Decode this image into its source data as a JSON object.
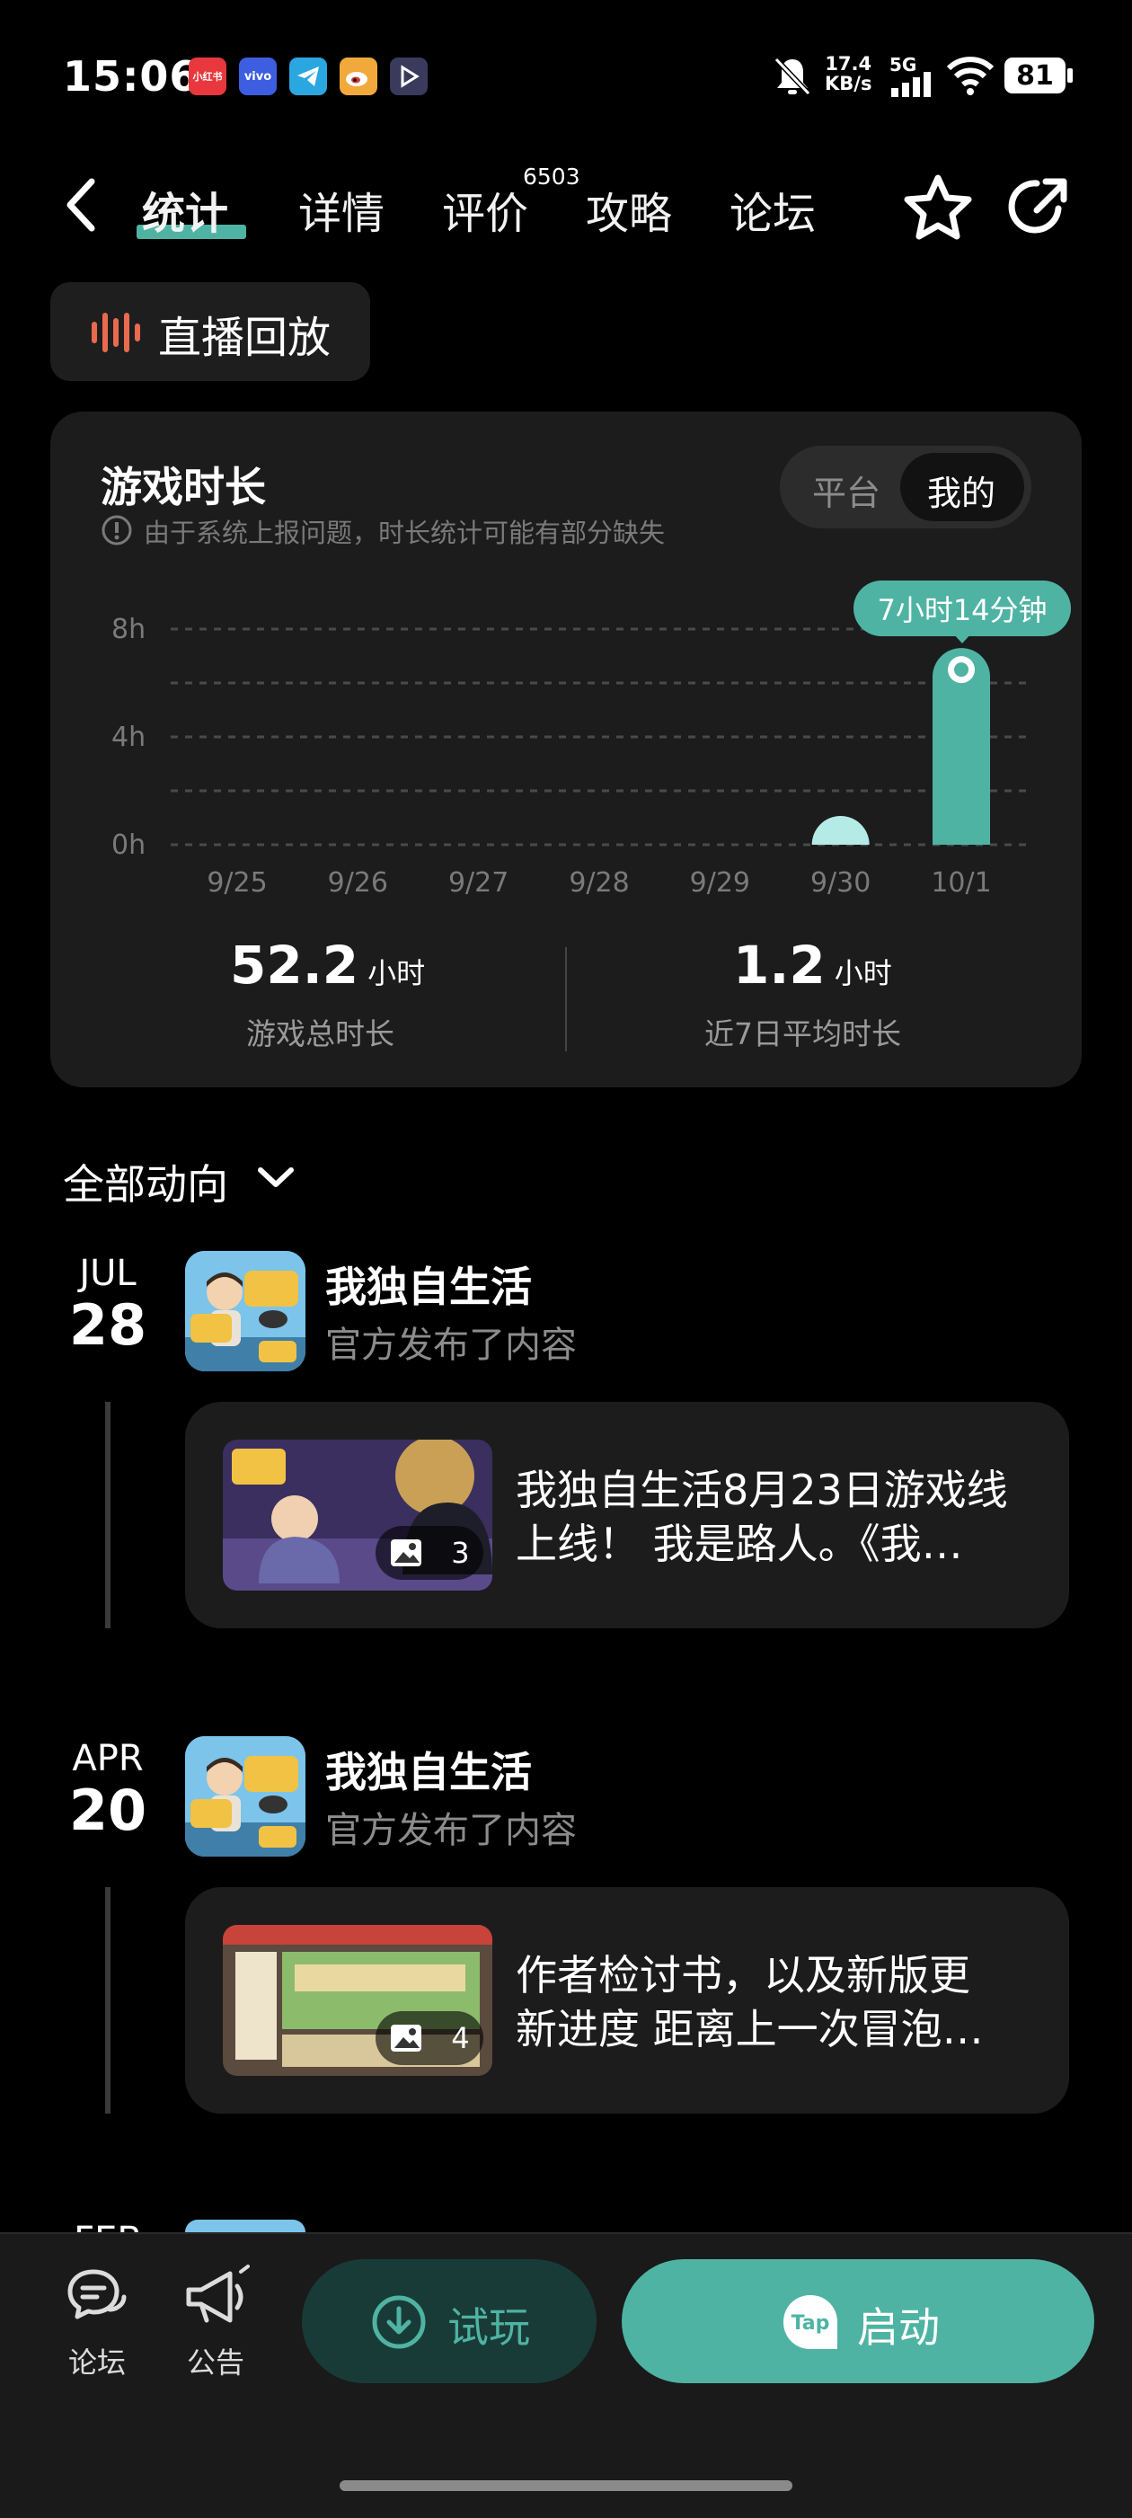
{
  "status_bar": {
    "time": "15:06",
    "apps": [
      {
        "icon": "xiaohongshu-icon",
        "label": "小红书",
        "color": "#e8383d"
      },
      {
        "icon": "vivo-icon",
        "label": "vivo",
        "color": "#3d5ee0"
      },
      {
        "icon": "telegram-icon",
        "label": "",
        "color": "#2aa7e0"
      },
      {
        "icon": "weibo-icon",
        "label": "",
        "color": "#f0a93a"
      },
      {
        "icon": "play-app-icon",
        "label": "",
        "color": "#3a3a5c"
      }
    ],
    "net_speed_value": "17.4",
    "net_speed_unit": "KB/s",
    "signal_label": "5G",
    "battery": "81"
  },
  "header": {
    "tabs": [
      {
        "label": "统计",
        "active": true
      },
      {
        "label": "详情",
        "active": false
      },
      {
        "label": "评价",
        "active": false
      },
      {
        "label": "攻略",
        "active": false
      },
      {
        "label": "论坛",
        "active": false
      }
    ],
    "review_count": "6503"
  },
  "live_replay": {
    "label": "直播回放"
  },
  "playtime_card": {
    "title": "游戏时长",
    "note": "由于系统上报问题，时长统计可能有部分缺失",
    "toggle": {
      "options": [
        "平台",
        "我的"
      ],
      "selected": "我的"
    },
    "tooltip": "7小时14分钟",
    "total_value": "52.2",
    "total_unit": "小时",
    "total_label": "游戏总时长",
    "avg_value": "1.2",
    "avg_unit": "小时",
    "avg_label": "近7日平均时长"
  },
  "chart_data": {
    "type": "bar",
    "categories": [
      "9/25",
      "9/26",
      "9/27",
      "9/28",
      "9/29",
      "9/30",
      "10/1"
    ],
    "values": [
      0,
      0,
      0,
      0,
      0,
      0.4,
      7.23
    ],
    "y_ticks": [
      "8h",
      "4h",
      "0h"
    ],
    "y_tick_values": [
      8,
      4,
      0
    ],
    "ylim": [
      0,
      8
    ],
    "grid": true,
    "colors": {
      "bar": "#4fb3a3",
      "small_bar": "#b5ebe6"
    }
  },
  "feed": {
    "filter_label": "全部动向",
    "entries": [
      {
        "month": "JUL",
        "day": "28",
        "game": "我独自生活",
        "action": "官方发布了内容",
        "image_count": "3",
        "text": "我独自生活8月23日游戏线上线！ 我是路人。《我…",
        "text_line1": "我独自生活8月23日游戏线",
        "text_line2": "上线！ 我是路人。《我…"
      },
      {
        "month": "APR",
        "day": "20",
        "game": "我独自生活",
        "action": "官方发布了内容",
        "image_count": "4",
        "text": "作者检讨书，以及新版更新进度 距离上一次冒泡…",
        "text_line1": "作者检讨书，以及新版更",
        "text_line2": "新进度 距离上一次冒泡…"
      }
    ],
    "partial_month": "FEB"
  },
  "bottom_bar": {
    "forum_label": "论坛",
    "notice_label": "公告",
    "try_label": "试玩",
    "start_label": "启动",
    "tap_logo": "Tap"
  }
}
